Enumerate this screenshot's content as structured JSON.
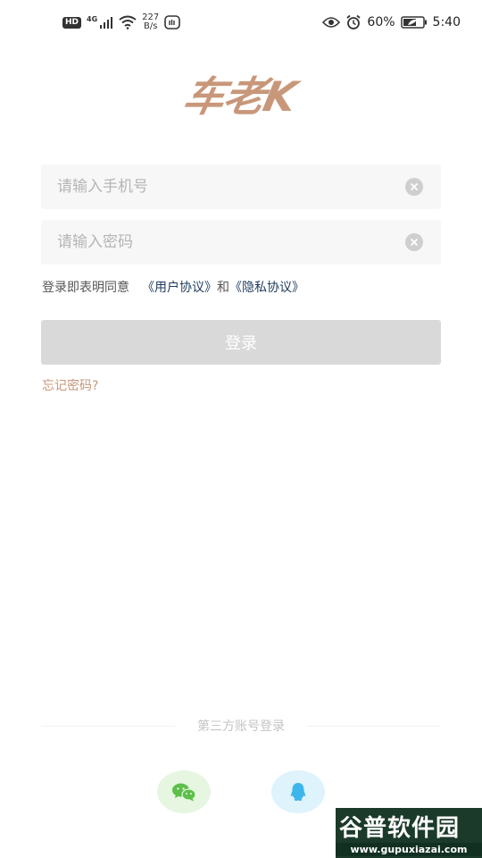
{
  "status_bar": {
    "hd": "HD",
    "network": "4G",
    "speed_value": "227",
    "speed_unit": "B/s",
    "battery": "60%",
    "time": "5:40"
  },
  "app": {
    "logo_text": "车老K"
  },
  "login_form": {
    "phone_placeholder": "请输入手机号",
    "password_placeholder": "请输入密码",
    "agreement_prefix": "登录即表明同意",
    "user_agreement": "《用户协议》",
    "conjunction": "和",
    "privacy_agreement": "《隐私协议》",
    "login_label": "登录",
    "forgot_password": "忘记密码?"
  },
  "third_party": {
    "label": "第三方账号登录",
    "options": [
      "wechat-icon",
      "qq-icon"
    ]
  },
  "watermark": {
    "brand": "谷普软件园",
    "url": "www.gupuxiazai.com"
  },
  "colors": {
    "accent": "#c8977a",
    "link": "#1e3b5c",
    "button_disabled": "#d9d9d9",
    "field_bg": "#f7f7f7",
    "wechat_bg": "#e6f6e1",
    "qq_bg": "#def3fb"
  }
}
